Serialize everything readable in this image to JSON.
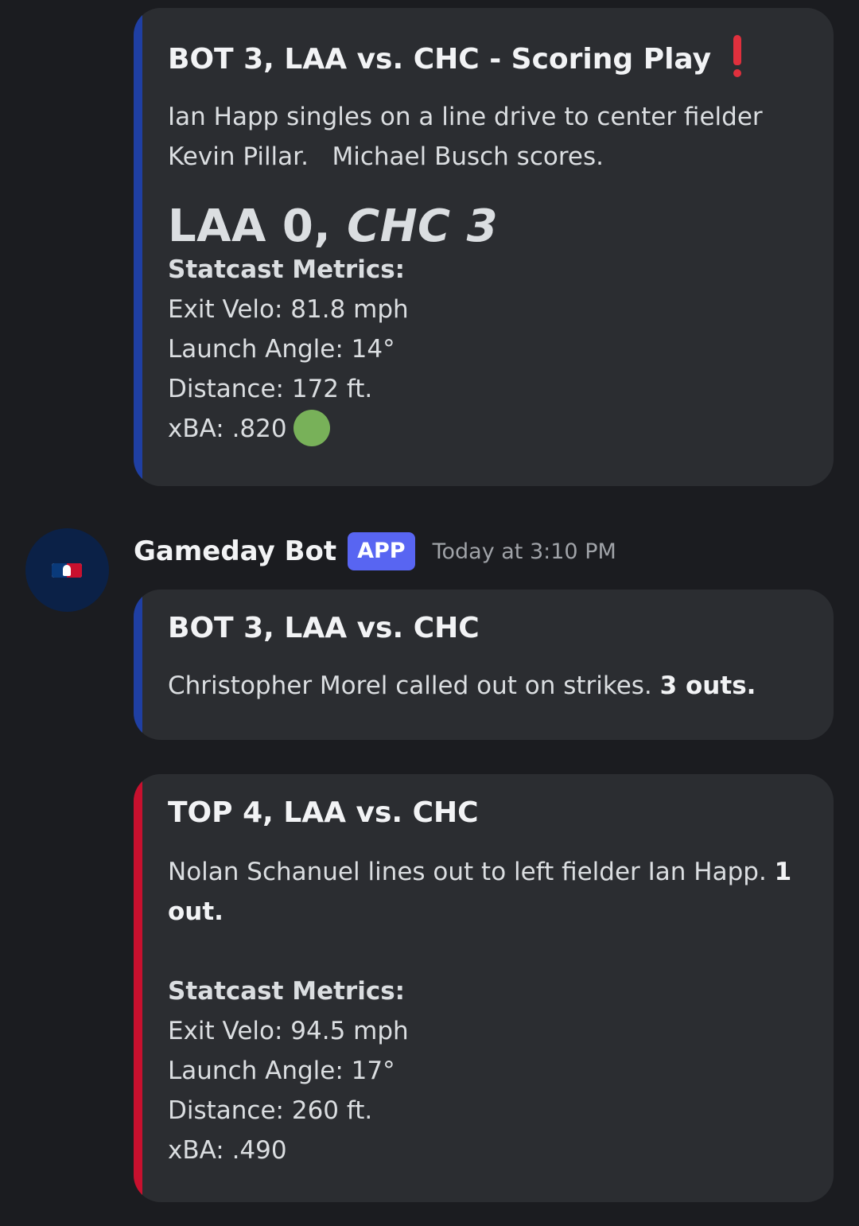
{
  "colors": {
    "background": "#1b1c20",
    "embed_background": "#2b2d31",
    "bot_accent": "#1f3fa3",
    "top_accent": "#c8102e",
    "app_badge": "#5865f2",
    "xba_indicator": "#78b159"
  },
  "embed1": {
    "title": "BOT 3, LAA vs. CHC - Scoring Play",
    "title_icon": "red-exclamation-icon",
    "desc_line1": "Ian Happ singles on a line drive to center fielder",
    "desc_line2": "Kevin Pillar.   Michael Busch scores.",
    "score_away": "LAA 0, ",
    "score_home": "CHC 3",
    "metrics_header": "Statcast Metrics:",
    "exit_velo": "Exit Velo: 81.8 mph",
    "launch_angle": "Launch Angle: 14°",
    "distance": "Distance: 172 ft.",
    "xba": "xBA: .820",
    "xba_icon": "green-circle-icon"
  },
  "message": {
    "avatar_icon": "mlb-logo-icon",
    "username": "Gameday Bot",
    "badge": "APP",
    "timestamp": "Today at 3:10 PM"
  },
  "embed2": {
    "title": "BOT 3, LAA vs. CHC",
    "desc": "Christopher Morel called out on strikes. ",
    "desc_bold": "3 outs."
  },
  "embed3": {
    "title": "TOP 4, LAA vs. CHC",
    "desc_line1": "Nolan Schanuel lines out to left fielder Ian Happ. ",
    "desc_bold1": "1",
    "desc_bold2": "out.",
    "metrics_header": "Statcast Metrics:",
    "exit_velo": "Exit Velo: 94.5 mph",
    "launch_angle": "Launch Angle: 17°",
    "distance": "Distance: 260 ft.",
    "xba": "xBA: .490"
  }
}
